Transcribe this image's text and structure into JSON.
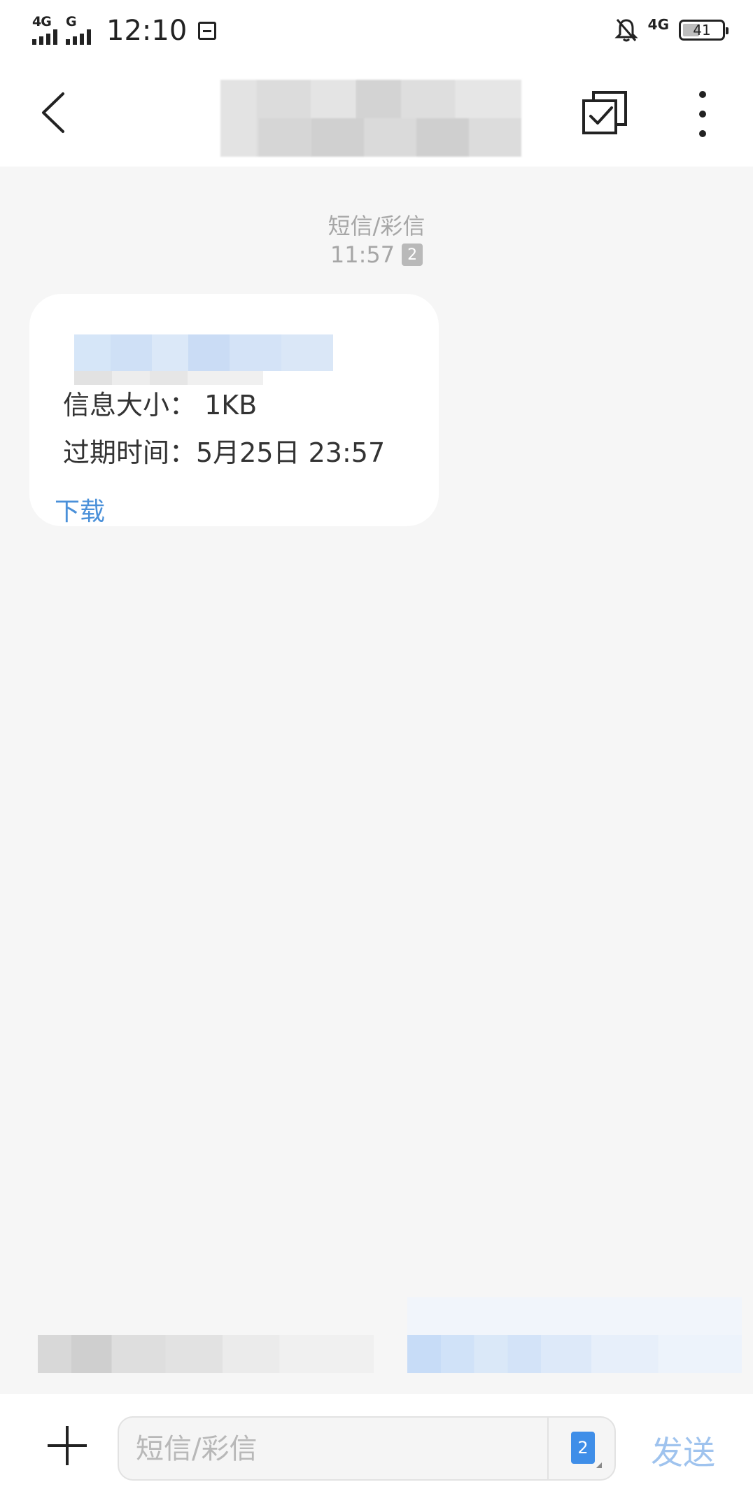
{
  "status_bar": {
    "sim1_network": "4G",
    "sim2_network": "G",
    "time": "12:10",
    "right_network": "4G",
    "battery": "41",
    "battery_level": 0.41
  },
  "header": {
    "back_icon": "chevron-left-icon",
    "multi_select_icon": "checkbox-multi-select-icon",
    "more_icon": "more-vertical-icon"
  },
  "thread": {
    "message_type": "短信/彩信",
    "time": "11:57",
    "sim_badge": "2"
  },
  "message": {
    "size_line": "信息大小：  1KB",
    "expire_line": "过期时间：5月25日 23:57",
    "download_label": "下载"
  },
  "compose": {
    "placeholder": "短信/彩信",
    "sim_label": "2",
    "send_label": "发送"
  },
  "colors": {
    "link": "#4a90d9",
    "send_disabled": "#9fc3ee",
    "sim_badge": "#3f8ee8"
  }
}
